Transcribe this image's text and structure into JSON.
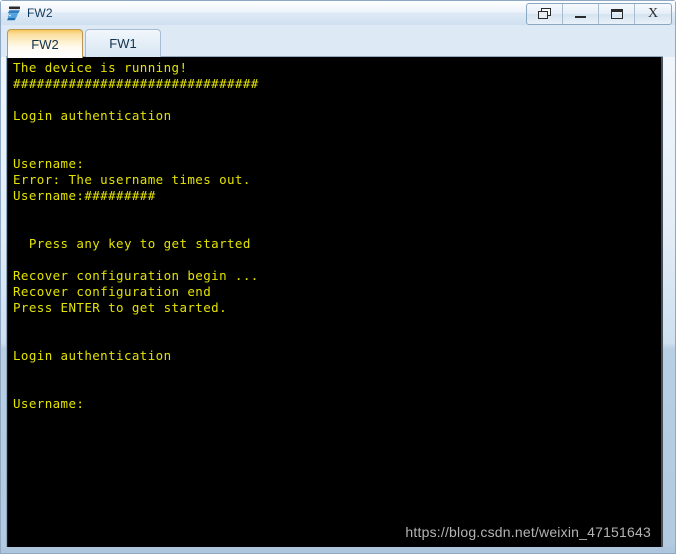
{
  "window": {
    "title": "FW2",
    "icon": "network-device-icon",
    "buttons": [
      {
        "name": "restore-button",
        "label": ""
      },
      {
        "name": "minimize-button",
        "label": ""
      },
      {
        "name": "maximize-button",
        "label": ""
      },
      {
        "name": "close-button",
        "label": "X"
      }
    ]
  },
  "tabs": [
    {
      "label": "FW2",
      "active": true
    },
    {
      "label": "FW1",
      "active": false
    }
  ],
  "terminal": {
    "background_color": "#000000",
    "text_color": "#e3e300",
    "content": "The device is running!\n###############################\n\nLogin authentication\n\n\nUsername:\nError: The username times out.\nUsername:#########\n\n\n  Press any key to get started\n\nRecover configuration begin ...\nRecover configuration end\nPress ENTER to get started.\n\n\nLogin authentication\n\n\nUsername:"
  },
  "watermark": {
    "text": "https://blog.csdn.net/weixin_47151643",
    "color": "#b4b4b4"
  }
}
